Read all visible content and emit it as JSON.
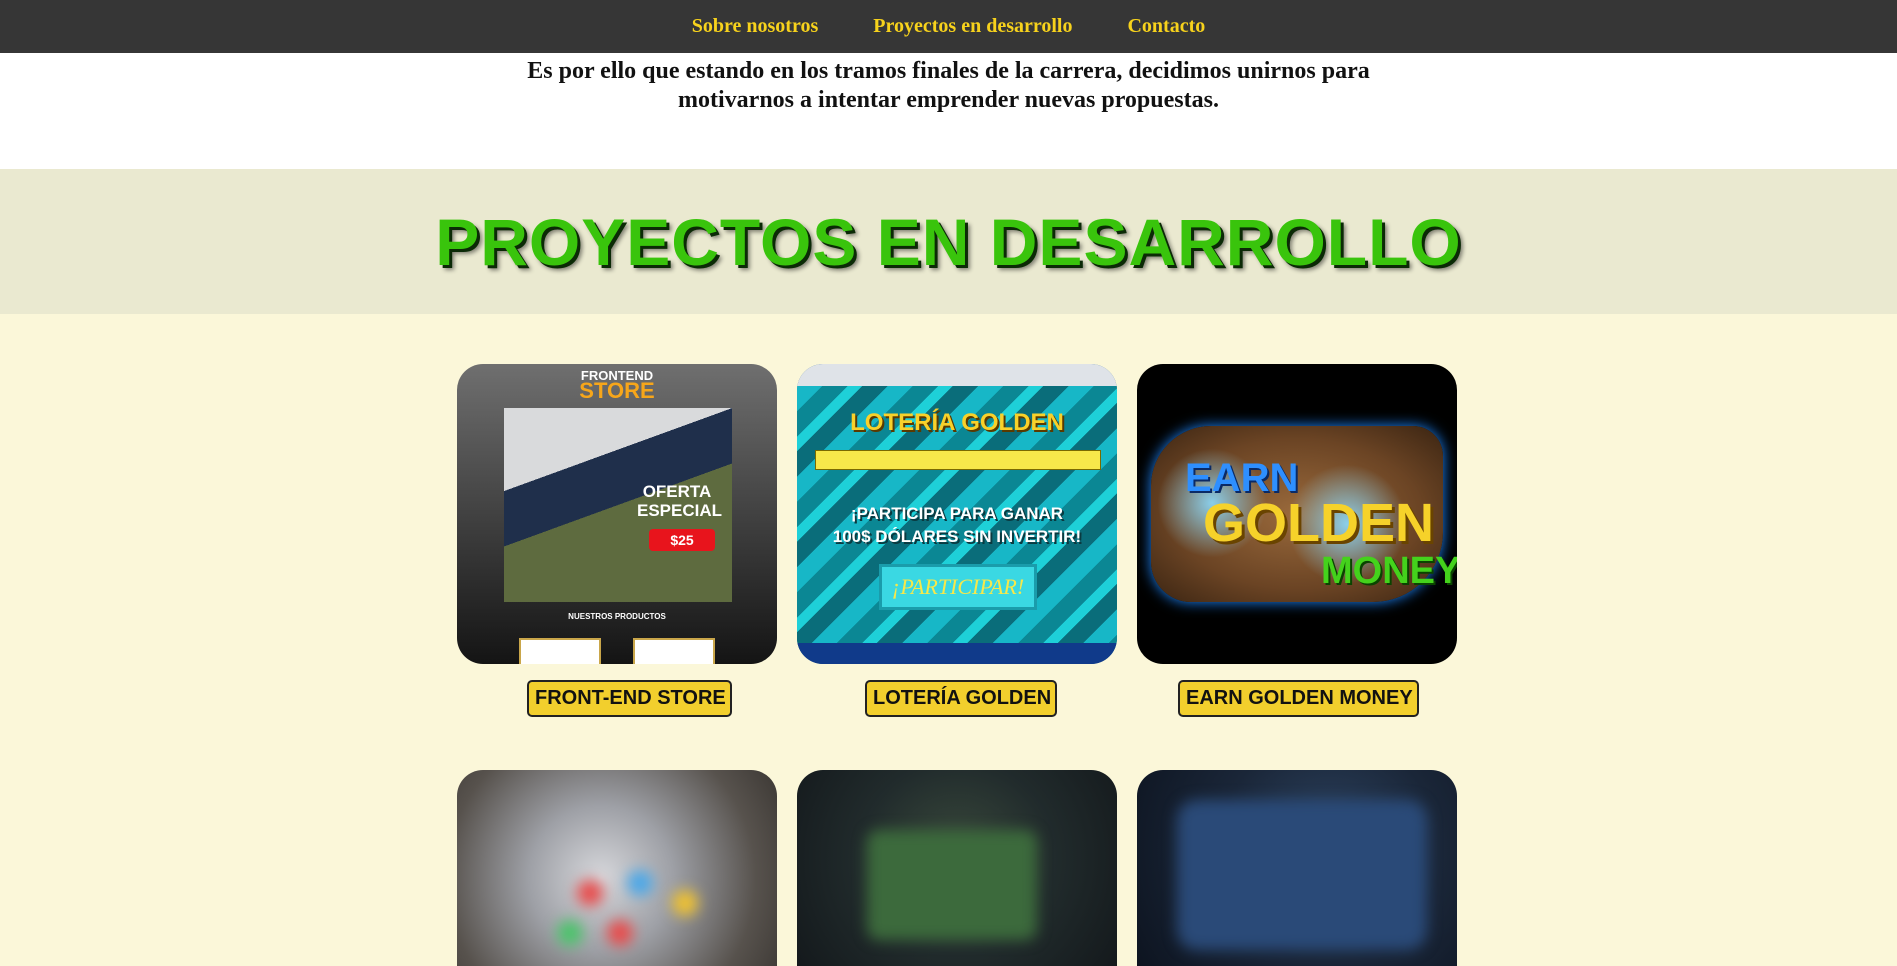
{
  "nav": {
    "items": [
      "Sobre nosotros",
      "Proyectos en desarrollo",
      "Contacto"
    ]
  },
  "intro": {
    "text": "Es por ello que estando en los tramos finales de la carrera, decidimos unirnos para motivarnos a intentar emprender nuevas propuestas."
  },
  "section": {
    "title": "PROYECTOS EN DESARROLLO"
  },
  "projects": [
    {
      "label": "FRONT-END STORE",
      "thumb": {
        "header_small": "FRONTEND",
        "header_big": "STORE",
        "offer": "OFERTA ESPECIAL",
        "price": "$25",
        "products": "NUESTROS PRODUCTOS"
      }
    },
    {
      "label": "LOTERÍA GOLDEN",
      "thumb": {
        "title": "LOTERÍA GOLDEN",
        "line1": "¡PARTICIPA PARA GANAR",
        "line2": "100$ DÓLARES SIN INVERTIR!",
        "button": "¡PARTICIPAR!"
      }
    },
    {
      "label": "EARN GOLDEN MONEY",
      "thumb": {
        "word1": "EARN",
        "word2": "GOLDEN",
        "word3": "MONEY"
      }
    },
    {
      "label": ""
    },
    {
      "label": ""
    },
    {
      "label": ""
    }
  ],
  "colors": {
    "nav_bg": "#363636",
    "nav_link": "#f7d21c",
    "title_green": "#39c40c",
    "band_bg": "#eae9d0",
    "page_bg": "#fbf7d9",
    "button_bg": "#f2cf2d"
  }
}
